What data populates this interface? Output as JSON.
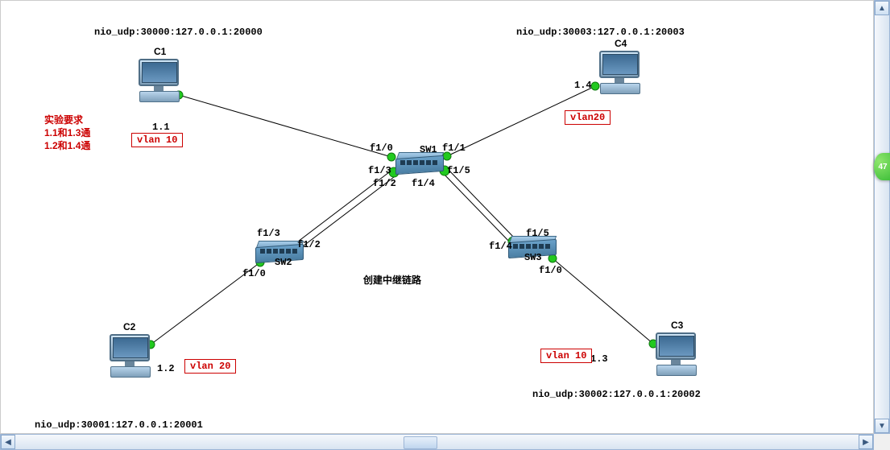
{
  "side_tab": "47",
  "requirements": {
    "title": "实验要求",
    "line1": "1.1和1.3通",
    "line2": "1.2和1.4通"
  },
  "center_note": "创建中继链路",
  "hosts": {
    "c1": {
      "name": "C1",
      "nio": "nio_udp:30000:127.0.0.1:20000",
      "ip": "1.1",
      "vlan": "vlan 10"
    },
    "c2": {
      "name": "C2",
      "nio": "nio_udp:30001:127.0.0.1:20001",
      "ip": "1.2",
      "vlan": "vlan 20"
    },
    "c3": {
      "name": "C3",
      "nio": "nio_udp:30002:127.0.0.1:20002",
      "ip": "1.3",
      "vlan": "vlan 10"
    },
    "c4": {
      "name": "C4",
      "nio": "nio_udp:30003:127.0.0.1:20003",
      "ip": "1.4",
      "vlan": "vlan20"
    }
  },
  "switches": {
    "sw1": "SW1",
    "sw2": "SW2",
    "sw3": "SW3"
  },
  "ports": {
    "sw1_f10": "f1/0",
    "sw1_f11": "f1/1",
    "sw1_f12": "f1/2",
    "sw1_f13": "f1/3",
    "sw1_f14": "f1/4",
    "sw1_f15": "f1/5",
    "sw2_f10": "f1/0",
    "sw2_f12": "f1/2",
    "sw2_f13": "f1/3",
    "sw3_f10": "f1/0",
    "sw3_f14": "f1/4",
    "sw3_f15": "f1/5"
  }
}
